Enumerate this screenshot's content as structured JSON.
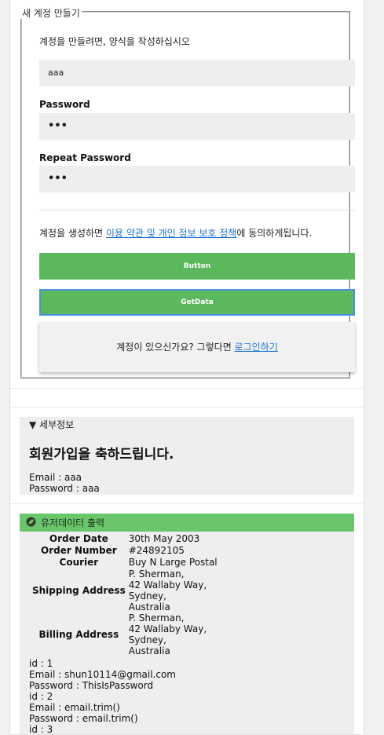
{
  "signup": {
    "legend": "새 계정 만들기",
    "instructions": "계정을 만들려면, 양식을 작성하십시오",
    "username_value": "aaa",
    "password_label": "Password",
    "password_value": "•••",
    "repeat_label": "Repeat Password",
    "repeat_value": "•••",
    "terms_prefix": "계정을 생성하면 ",
    "terms_link": "이용 약관 및 개인 정보 보호 정책",
    "terms_suffix": "에 동의하게됩니다.",
    "button_label": "Button",
    "getdata_label": "GetData",
    "signin_prefix": "계정이 있으신가요? 그렇다면 ",
    "signin_link": "로그인하기"
  },
  "details": {
    "summary": "▼ 세부정보",
    "title": "회원가입을 축하드립니다.",
    "email_line": "Email : aaa",
    "password_line": "Password : aaa"
  },
  "userdata": {
    "header_title": "유저데이터 출력",
    "icon": "leaf-icon",
    "order": {
      "order_date_label": "Order Date",
      "order_date_value": "30th May 2003",
      "order_number_label": "Order Number",
      "order_number_value": "#24892105",
      "courier_label": "Courier",
      "courier_value": "Buy N Large Postal",
      "shipping_label": "Shipping Address",
      "shipping_lines": [
        "P. Sherman,",
        "42 Wallaby Way,",
        "Sydney,",
        "Australia"
      ],
      "billing_label": "Billing Address",
      "billing_lines": [
        "P. Sherman,",
        "42 Wallaby Way,",
        "Sydney,",
        "Australia"
      ]
    },
    "users": [
      "id : 1",
      "Email : shun10114@gmail.com",
      "Password : ThisIsPassword",
      "id : 2",
      "Email : email.trim()",
      "Password : email.trim()",
      "id : 3"
    ]
  },
  "colors": {
    "button_green": "#5cb85c",
    "header_green": "#6ac66a",
    "link_blue": "#1e73d8",
    "focus_blue": "#4a90e2"
  }
}
